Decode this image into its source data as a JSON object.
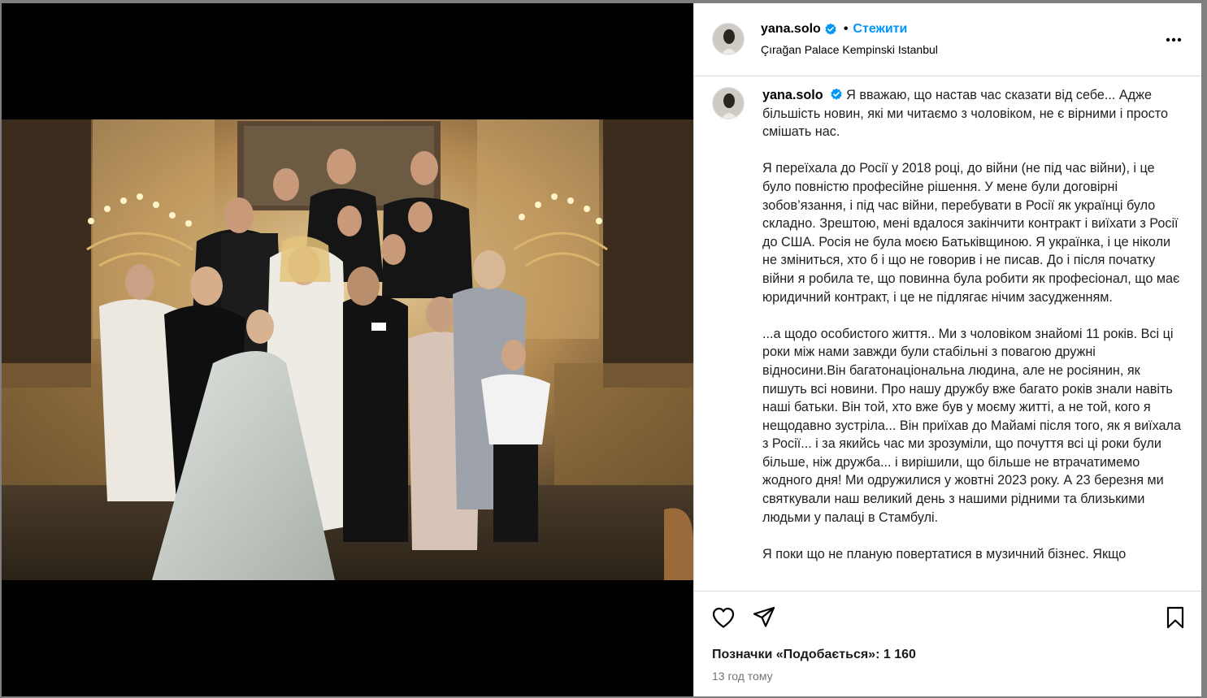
{
  "post": {
    "username": "yana.solo",
    "follow_label": "Стежити",
    "location": "Çırağan Palace Kempinski Istanbul",
    "caption_username": "yana.solo",
    "caption_paragraphs": [
      "Я вважаю, що настав час сказати від себе... Адже більшість новин, які ми читаємо з чоловіком, не є вірними і просто смішать нас.",
      "Я переїхала до Росії у 2018 році, до війни (не під час війни), і це було повністю професійне рішення. У мене були договірні зобов’язання, і під час війни, перебувати в Росії як українці було складно. Зрештою, мені вдалося закінчити контракт і виїхати з Росії до США. Росія не була моєю Батьківщиною. Я українка, і це ніколи не зміниться, хто б і що не говорив і не писав. До і після початку війни я робила те, що повинна була робити як професіонал, що має юридичний контракт, і це не підлягає нічим засудженням.",
      "...а щодо особистого життя.. Ми з чоловіком знайомі 11 років. Всі ці роки між нами завжди були стабільні з повагою дружні відносини.Він багатонаціональна людина, але не росіянин, як пишуть всі новини. Про нашу дружбу вже багато років знали навіть наші батьки. Він той, хто вже був у моєму житті, а не той, кого я нещодавно зустріла... Він приїхав до Майамі після того, як я виїхала з Росії... і за якийсь час ми зрозуміли, що почуття всі ці роки були більше, ніж дружба... і вирішили, що більше не втрачатимемо жодного дня! Ми одружилися у жовтні 2023 року. А 23 березня ми святкували наш великий день з нашими рідними та близькими людьми у палаці в Стамбулі.",
      "Я поки що не планую повертатися в музичний бізнес. Якщо"
    ],
    "likes_text": "Позначки «Подобається»: 1 160",
    "time_ago": "13 год тому"
  },
  "icons": {
    "verified": "verified-badge-icon",
    "more": "more-options-icon",
    "like": "heart-icon",
    "share": "paper-plane-icon",
    "save": "bookmark-icon"
  },
  "colors": {
    "link_blue": "#0095f6",
    "verified_blue": "#0095f6",
    "muted_text": "#737373",
    "divider": "#dbdbdb"
  }
}
